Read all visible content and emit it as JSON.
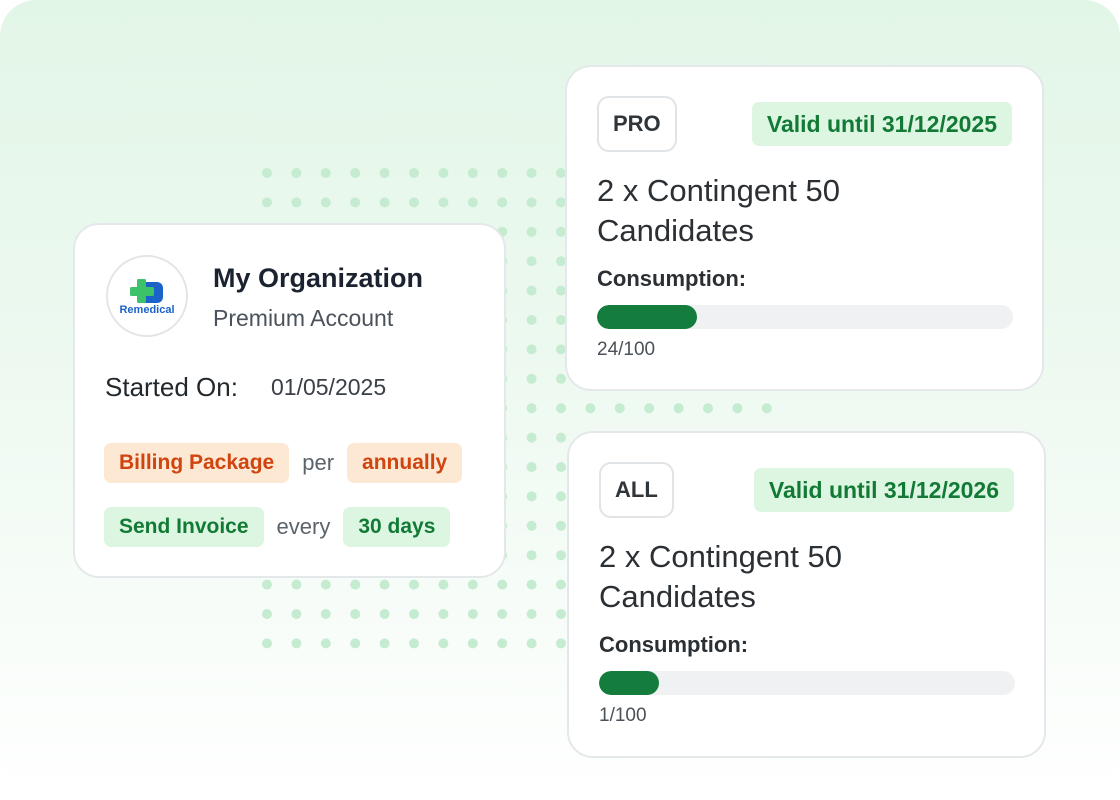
{
  "organization": {
    "logo_text": "Remedical",
    "name": "My Organization",
    "account_type": "Premium Account",
    "started_on_label": "Started On:",
    "started_on_value": "01/05/2025",
    "billing": {
      "label": "Billing Package",
      "joiner": "per",
      "period": "annually"
    },
    "invoice": {
      "label": "Send Invoice",
      "joiner": "every",
      "interval": "30 days"
    }
  },
  "subscriptions": [
    {
      "tier": "PRO",
      "validity": "Valid until 31/12/2025",
      "title": "2 x Contingent 50 Candidates",
      "consumption_label": "Consumption:",
      "used": 24,
      "total": 100,
      "usage_text": "24/100"
    },
    {
      "tier": "ALL",
      "validity": "Valid until 31/12/2026",
      "title": "2 x Contingent 50 Candidates",
      "consumption_label": "Consumption:",
      "used": 1,
      "total": 100,
      "usage_text": "1/100"
    }
  ],
  "colors": {
    "accent_green": "#147c3c",
    "badge_green_bg": "#dcf6e2",
    "badge_orange_bg": "#fde8d4",
    "badge_orange_text": "#d0440f",
    "dots": "#c5ebd0"
  },
  "icons": {
    "logo": "medical-cross-logo"
  }
}
